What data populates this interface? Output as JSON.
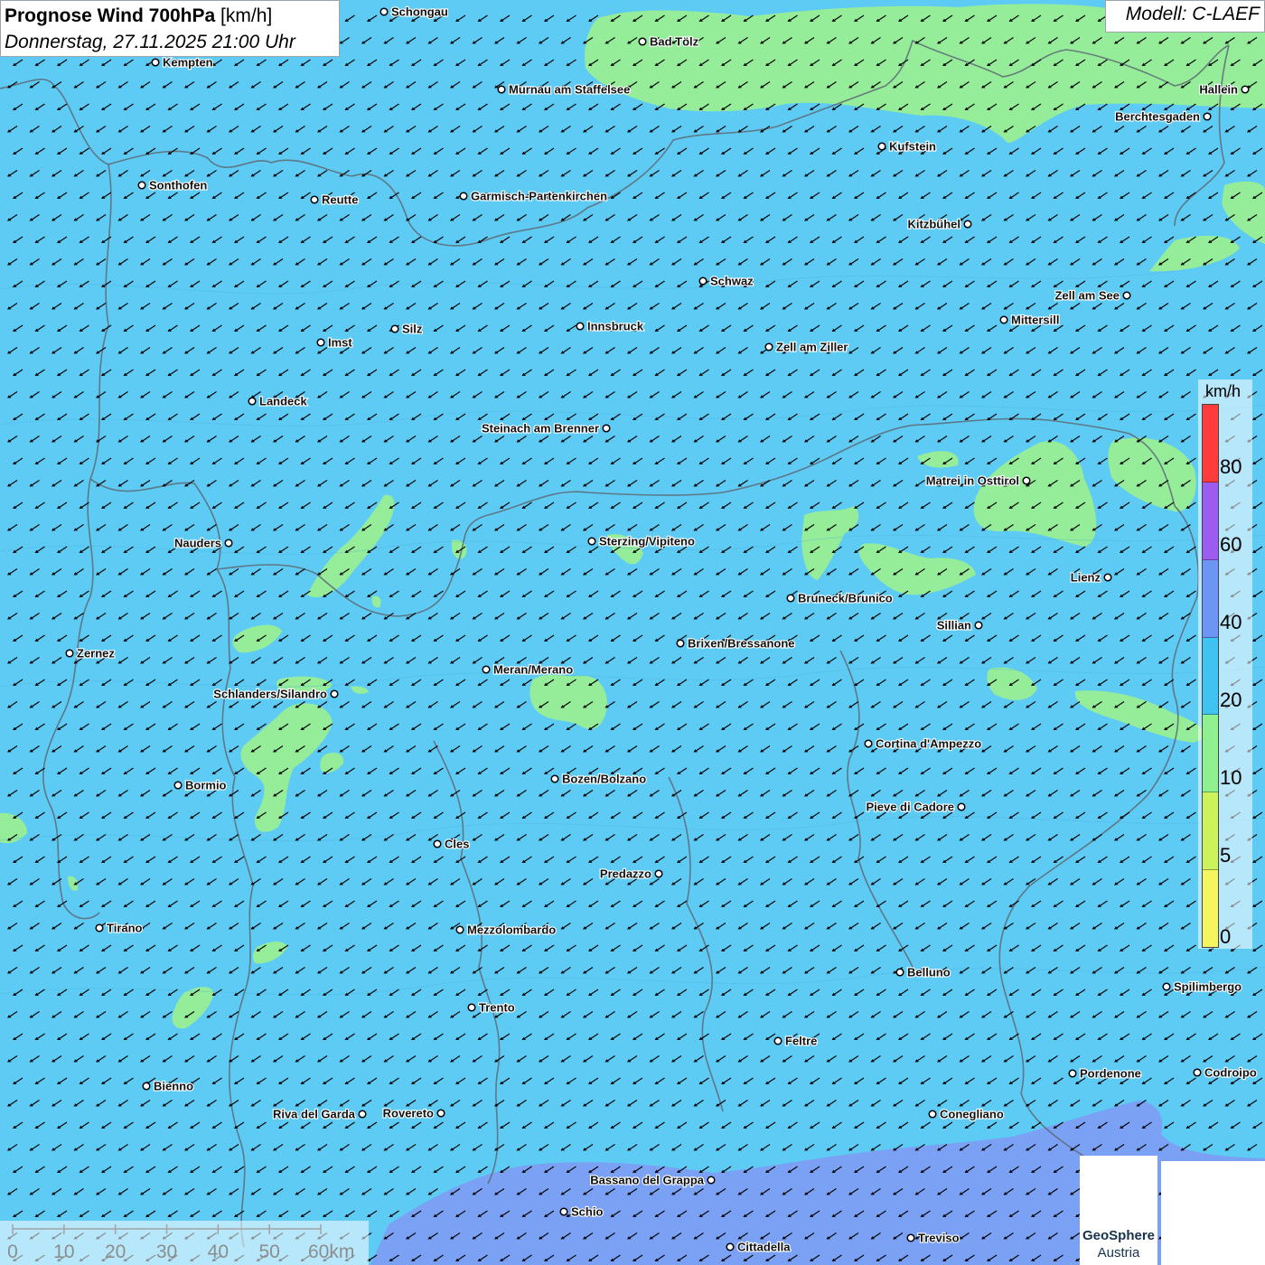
{
  "title": {
    "main_bold": "Prognose Wind 700hPa",
    "unit": "[km/h]",
    "subtitle": "Donnerstag, 27.11.2025 21:00 Uhr"
  },
  "model": "Modell: C-LAEF",
  "legend": {
    "unit": "km/h",
    "bins": [
      {
        "color": "#ff3b3b"
      },
      {
        "color": "#9d5cf0"
      },
      {
        "color": "#6c95f5"
      },
      {
        "color": "#3fc3f0"
      },
      {
        "color": "#8ef08e"
      },
      {
        "color": "#ccf25c"
      },
      {
        "color": "#f5f560"
      }
    ],
    "ticks": [
      "80",
      "60",
      "40",
      "20",
      "10",
      "5",
      "0"
    ]
  },
  "scale": {
    "labels": [
      "0",
      "10",
      "20",
      "30",
      "40",
      "50",
      "60km"
    ]
  },
  "logo": {
    "name": "GeoSphere",
    "sub": "Austria"
  },
  "cities": [
    {
      "name": "Schongau"
    },
    {
      "name": "Bad Tölz"
    },
    {
      "name": "Kempten"
    },
    {
      "name": "Murnau am Staffelsee"
    },
    {
      "name": "Hallein"
    },
    {
      "name": "Berchtesgaden"
    },
    {
      "name": "Kufstein"
    },
    {
      "name": "Sonthofen"
    },
    {
      "name": "Reutte"
    },
    {
      "name": "Garmisch-Partenkirchen"
    },
    {
      "name": "Kitzbühel"
    },
    {
      "name": "Schwaz"
    },
    {
      "name": "Zell am See"
    },
    {
      "name": "Mittersill"
    },
    {
      "name": "Imst"
    },
    {
      "name": "Silz"
    },
    {
      "name": "Innsbruck"
    },
    {
      "name": "Zell am Ziller"
    },
    {
      "name": "Landeck"
    },
    {
      "name": "Steinach am Brenner"
    },
    {
      "name": "Matrei in Osttirol"
    },
    {
      "name": "Nauders"
    },
    {
      "name": "Sterzing/Vipiteno"
    },
    {
      "name": "Lienz"
    },
    {
      "name": "Bruneck/Brunico"
    },
    {
      "name": "Sillian"
    },
    {
      "name": "Zernez"
    },
    {
      "name": "Brixen/Bressanone"
    },
    {
      "name": "Meran/Merano"
    },
    {
      "name": "Schlanders/Silandro"
    },
    {
      "name": "Cortina d'Ampezzo"
    },
    {
      "name": "Bozen/Bolzano"
    },
    {
      "name": "Bormio"
    },
    {
      "name": "Pieve di Cadore"
    },
    {
      "name": "Cles"
    },
    {
      "name": "Predazzo"
    },
    {
      "name": "Tirano"
    },
    {
      "name": "Mezzolombardo"
    },
    {
      "name": "Belluno"
    },
    {
      "name": "Spilimbergo"
    },
    {
      "name": "Trento"
    },
    {
      "name": "Feltre"
    },
    {
      "name": "Pordenone"
    },
    {
      "name": "Codroipo"
    },
    {
      "name": "Bienno"
    },
    {
      "name": "Riva del Garda"
    },
    {
      "name": "Rovereto"
    },
    {
      "name": "Conegliano"
    },
    {
      "name": "Bassano del Grappa"
    },
    {
      "name": "Schio"
    },
    {
      "name": "Treviso"
    },
    {
      "name": "Cittadella"
    }
  ]
}
